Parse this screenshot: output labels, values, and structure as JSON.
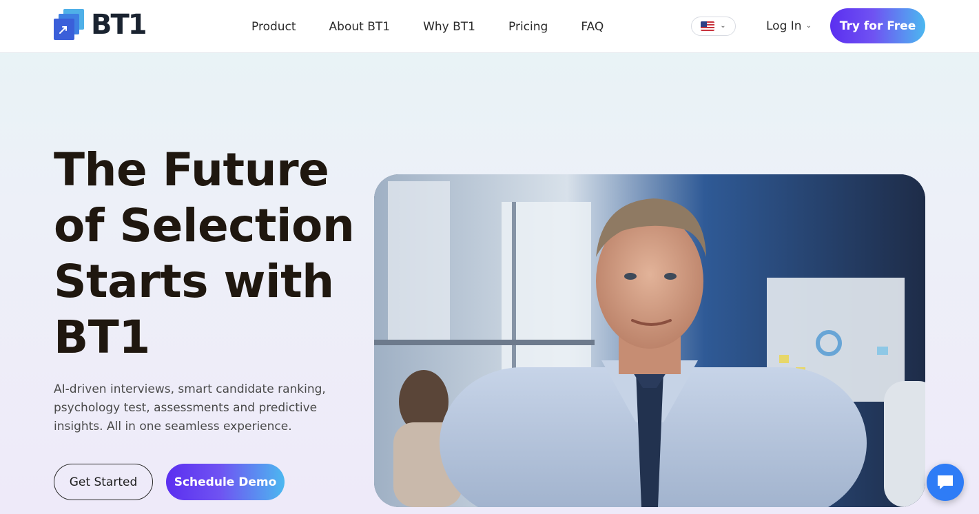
{
  "brand": {
    "name": "BT1"
  },
  "nav": {
    "items": [
      {
        "label": "Product"
      },
      {
        "label": "About BT1"
      },
      {
        "label": "Why BT1"
      },
      {
        "label": "Pricing"
      },
      {
        "label": "FAQ"
      }
    ]
  },
  "header": {
    "language_icon": "us-flag-icon",
    "login_label": "Log In",
    "try_label": "Try for Free"
  },
  "hero": {
    "title": "The Future of Selection Starts with BT1",
    "subtitle": "AI-driven interviews, smart candidate ranking, psychology test, assessments and predictive insights. All in one seamless experience.",
    "get_started_label": "Get Started",
    "schedule_demo_label": "Schedule Demo"
  },
  "chat": {
    "icon": "chat-bubble-icon"
  },
  "colors": {
    "accent_purple": "#5b2ff0",
    "accent_blue": "#4cb8f0",
    "chat_blue": "#2e7cf6",
    "title_dark": "#1f170f"
  }
}
